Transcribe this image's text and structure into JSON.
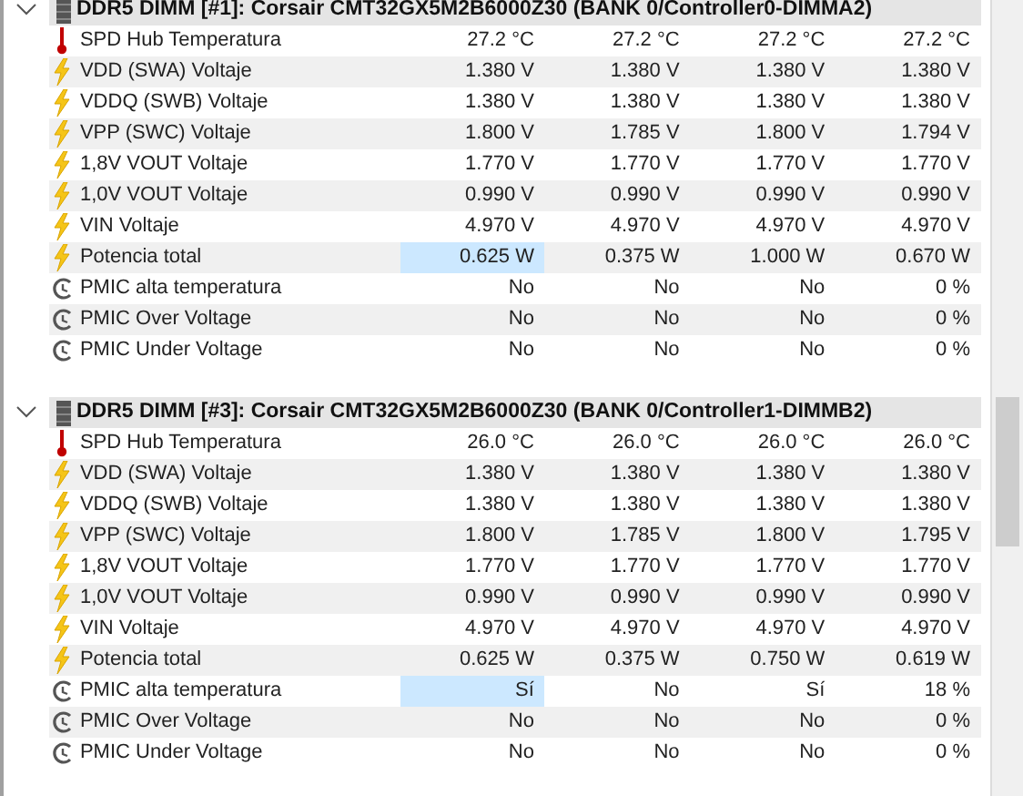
{
  "sections": [
    {
      "title": "DDR5 DIMM [#1]: Corsair CMT32GX5M2B6000Z30 (BANK 0/Controller0-DIMMA2)",
      "expanded": true,
      "rows": [
        {
          "kind": "temperature",
          "label": "SPD Hub Temperatura",
          "values": [
            {
              "text": "27.2 °C",
              "selected": false
            },
            {
              "text": "27.2 °C",
              "selected": false
            },
            {
              "text": "27.2 °C",
              "selected": false
            },
            {
              "text": "27.2 °C",
              "selected": false
            }
          ]
        },
        {
          "kind": "electric",
          "label": "VDD (SWA) Voltaje",
          "values": [
            {
              "text": "1.380 V",
              "selected": false
            },
            {
              "text": "1.380 V",
              "selected": false
            },
            {
              "text": "1.380 V",
              "selected": false
            },
            {
              "text": "1.380 V",
              "selected": false
            }
          ]
        },
        {
          "kind": "electric",
          "label": "VDDQ (SWB) Voltaje",
          "values": [
            {
              "text": "1.380 V",
              "selected": false
            },
            {
              "text": "1.380 V",
              "selected": false
            },
            {
              "text": "1.380 V",
              "selected": false
            },
            {
              "text": "1.380 V",
              "selected": false
            }
          ]
        },
        {
          "kind": "electric",
          "label": "VPP (SWC) Voltaje",
          "values": [
            {
              "text": "1.800 V",
              "selected": false
            },
            {
              "text": "1.785 V",
              "selected": false
            },
            {
              "text": "1.800 V",
              "selected": false
            },
            {
              "text": "1.794 V",
              "selected": false
            }
          ]
        },
        {
          "kind": "electric",
          "label": "1,8V VOUT Voltaje",
          "values": [
            {
              "text": "1.770 V",
              "selected": false
            },
            {
              "text": "1.770 V",
              "selected": false
            },
            {
              "text": "1.770 V",
              "selected": false
            },
            {
              "text": "1.770 V",
              "selected": false
            }
          ]
        },
        {
          "kind": "electric",
          "label": "1,0V VOUT Voltaje",
          "values": [
            {
              "text": "0.990 V",
              "selected": false
            },
            {
              "text": "0.990 V",
              "selected": false
            },
            {
              "text": "0.990 V",
              "selected": false
            },
            {
              "text": "0.990 V",
              "selected": false
            }
          ]
        },
        {
          "kind": "electric",
          "label": "VIN Voltaje",
          "values": [
            {
              "text": "4.970 V",
              "selected": false
            },
            {
              "text": "4.970 V",
              "selected": false
            },
            {
              "text": "4.970 V",
              "selected": false
            },
            {
              "text": "4.970 V",
              "selected": false
            }
          ]
        },
        {
          "kind": "electric",
          "label": "Potencia total",
          "values": [
            {
              "text": "0.625 W",
              "selected": true
            },
            {
              "text": "0.375 W",
              "selected": false
            },
            {
              "text": "1.000 W",
              "selected": false
            },
            {
              "text": "0.670 W",
              "selected": false
            }
          ]
        },
        {
          "kind": "status",
          "label": "PMIC alta temperatura",
          "values": [
            {
              "text": "No",
              "selected": false
            },
            {
              "text": "No",
              "selected": false
            },
            {
              "text": "No",
              "selected": false
            },
            {
              "text": "0 %",
              "selected": false
            }
          ]
        },
        {
          "kind": "status",
          "label": "PMIC Over Voltage",
          "values": [
            {
              "text": "No",
              "selected": false
            },
            {
              "text": "No",
              "selected": false
            },
            {
              "text": "No",
              "selected": false
            },
            {
              "text": "0 %",
              "selected": false
            }
          ]
        },
        {
          "kind": "status",
          "label": "PMIC Under Voltage",
          "values": [
            {
              "text": "No",
              "selected": false
            },
            {
              "text": "No",
              "selected": false
            },
            {
              "text": "No",
              "selected": false
            },
            {
              "text": "0 %",
              "selected": false
            }
          ]
        }
      ]
    },
    {
      "title": "DDR5 DIMM [#3]: Corsair CMT32GX5M2B6000Z30 (BANK 0/Controller1-DIMMB2)",
      "expanded": true,
      "rows": [
        {
          "kind": "temperature",
          "label": "SPD Hub Temperatura",
          "values": [
            {
              "text": "26.0 °C",
              "selected": false
            },
            {
              "text": "26.0 °C",
              "selected": false
            },
            {
              "text": "26.0 °C",
              "selected": false
            },
            {
              "text": "26.0 °C",
              "selected": false
            }
          ]
        },
        {
          "kind": "electric",
          "label": "VDD (SWA) Voltaje",
          "values": [
            {
              "text": "1.380 V",
              "selected": false
            },
            {
              "text": "1.380 V",
              "selected": false
            },
            {
              "text": "1.380 V",
              "selected": false
            },
            {
              "text": "1.380 V",
              "selected": false
            }
          ]
        },
        {
          "kind": "electric",
          "label": "VDDQ (SWB) Voltaje",
          "values": [
            {
              "text": "1.380 V",
              "selected": false
            },
            {
              "text": "1.380 V",
              "selected": false
            },
            {
              "text": "1.380 V",
              "selected": false
            },
            {
              "text": "1.380 V",
              "selected": false
            }
          ]
        },
        {
          "kind": "electric",
          "label": "VPP (SWC) Voltaje",
          "values": [
            {
              "text": "1.800 V",
              "selected": false
            },
            {
              "text": "1.785 V",
              "selected": false
            },
            {
              "text": "1.800 V",
              "selected": false
            },
            {
              "text": "1.795 V",
              "selected": false
            }
          ]
        },
        {
          "kind": "electric",
          "label": "1,8V VOUT Voltaje",
          "values": [
            {
              "text": "1.770 V",
              "selected": false
            },
            {
              "text": "1.770 V",
              "selected": false
            },
            {
              "text": "1.770 V",
              "selected": false
            },
            {
              "text": "1.770 V",
              "selected": false
            }
          ]
        },
        {
          "kind": "electric",
          "label": "1,0V VOUT Voltaje",
          "values": [
            {
              "text": "0.990 V",
              "selected": false
            },
            {
              "text": "0.990 V",
              "selected": false
            },
            {
              "text": "0.990 V",
              "selected": false
            },
            {
              "text": "0.990 V",
              "selected": false
            }
          ]
        },
        {
          "kind": "electric",
          "label": "VIN Voltaje",
          "values": [
            {
              "text": "4.970 V",
              "selected": false
            },
            {
              "text": "4.970 V",
              "selected": false
            },
            {
              "text": "4.970 V",
              "selected": false
            },
            {
              "text": "4.970 V",
              "selected": false
            }
          ]
        },
        {
          "kind": "electric",
          "label": "Potencia total",
          "values": [
            {
              "text": "0.625 W",
              "selected": false
            },
            {
              "text": "0.375 W",
              "selected": false
            },
            {
              "text": "0.750 W",
              "selected": false
            },
            {
              "text": "0.619 W",
              "selected": false
            }
          ]
        },
        {
          "kind": "status",
          "label": "PMIC alta temperatura",
          "values": [
            {
              "text": "Sí",
              "selected": true
            },
            {
              "text": "No",
              "selected": false
            },
            {
              "text": "Sí",
              "selected": false
            },
            {
              "text": "18 %",
              "selected": false
            }
          ]
        },
        {
          "kind": "status",
          "label": "PMIC Over Voltage",
          "values": [
            {
              "text": "No",
              "selected": false
            },
            {
              "text": "No",
              "selected": false
            },
            {
              "text": "No",
              "selected": false
            },
            {
              "text": "0 %",
              "selected": false
            }
          ]
        },
        {
          "kind": "status",
          "label": "PMIC Under Voltage",
          "values": [
            {
              "text": "No",
              "selected": false
            },
            {
              "text": "No",
              "selected": false
            },
            {
              "text": "No",
              "selected": false
            },
            {
              "text": "0 %",
              "selected": false
            }
          ]
        }
      ]
    }
  ]
}
